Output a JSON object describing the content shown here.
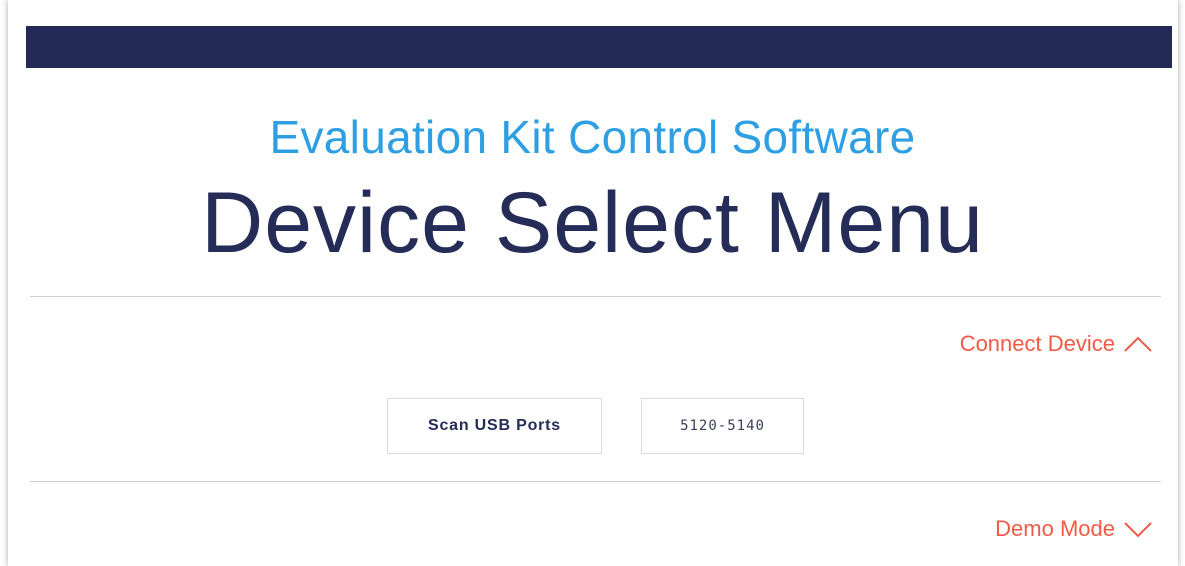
{
  "header": {
    "subtitle": "Evaluation Kit Control Software",
    "title": "Device Select Menu"
  },
  "connect_section": {
    "toggle_label": "Connect Device",
    "toggle_icon": "chevron-up-icon",
    "expanded": true,
    "buttons": {
      "scan_label": "Scan USB Ports",
      "device_label": "5120-5140"
    }
  },
  "demo_section": {
    "toggle_label": "Demo Mode",
    "toggle_icon": "chevron-down-icon",
    "expanded": false
  },
  "colors": {
    "topbar": "#222a55",
    "subtitle": "#2f9fe4",
    "title": "#242c57",
    "accent": "#f05a47",
    "divider": "#cfcfcf"
  }
}
